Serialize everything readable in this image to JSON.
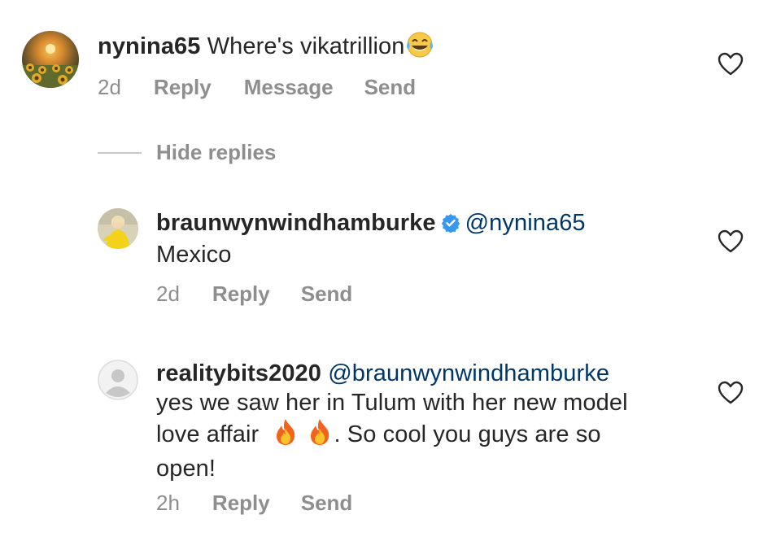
{
  "comments": [
    {
      "username": "nynina65",
      "mention": "",
      "text": "Where's vikatrillion",
      "emoji_after": "laughing-tears-emoji",
      "time": "2d",
      "actions": [
        "Reply",
        "Message",
        "Send"
      ]
    },
    {
      "username": "braunwynwindhamburke",
      "verified": true,
      "mention": "@nynina65",
      "text": "Mexico",
      "time": "2d",
      "actions": [
        "Reply",
        "Send"
      ]
    },
    {
      "username": "realitybits2020",
      "mention": "@braunwynwindhamburke",
      "text_line1": "yes we saw her in Tulum with her new model",
      "text_line2_before": "love affair",
      "text_line2_after": ". So cool you guys are so",
      "text_line3": "open!",
      "time": "2h",
      "actions": [
        "Reply",
        "Send"
      ]
    }
  ],
  "hide_replies_label": "Hide replies",
  "colors": {
    "text": "#262626",
    "muted": "#8e8e8e",
    "mention": "#00376b",
    "verified": "#3897f0",
    "divider": "#c7c7c7"
  }
}
